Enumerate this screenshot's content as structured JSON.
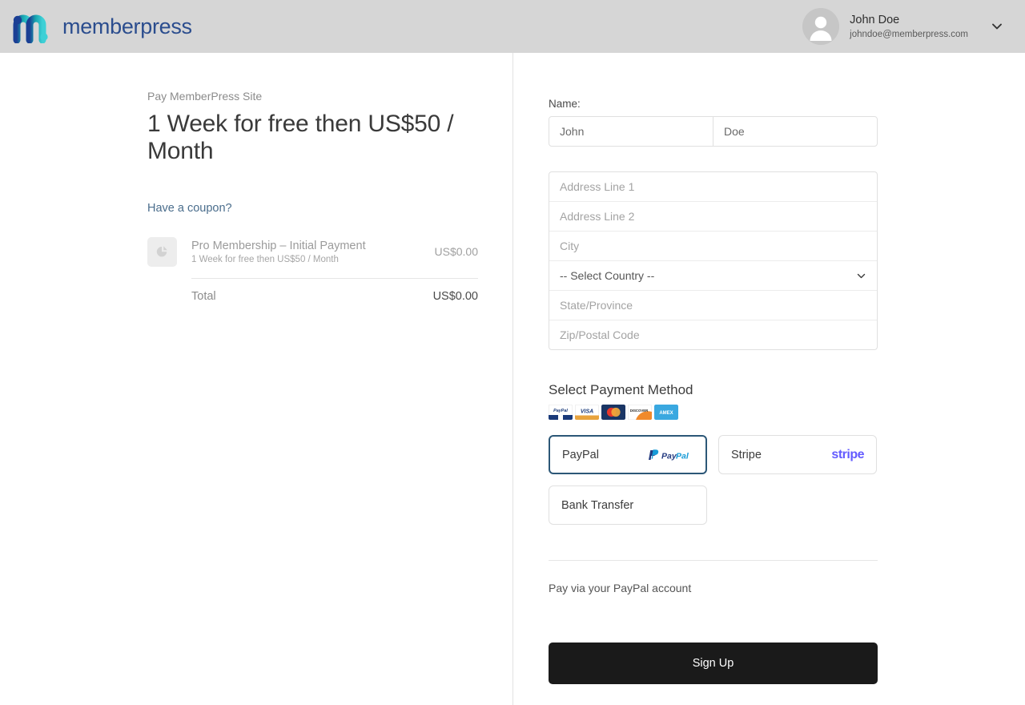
{
  "header": {
    "brand_name": "memberpress",
    "brand_logo_icon": "memberpress-m-logo",
    "user": {
      "name": "John Doe",
      "email": "johndoe@memberpress.com",
      "avatar_icon": "user-avatar-icon",
      "chevron_icon": "chevron-down-icon"
    }
  },
  "summary": {
    "pay_site_label": "Pay MemberPress Site",
    "plan_title": "1 Week for free then US$50 / Month",
    "coupon_link": "Have a coupon?",
    "item": {
      "thumb_icon": "image-placeholder-icon",
      "name": "Pro Membership – Initial Payment",
      "subtitle": "1 Week for free then US$50 / Month",
      "price": "US$0.00"
    },
    "total_label": "Total",
    "total_value": "US$0.00"
  },
  "form": {
    "name_label": "Name:",
    "first_name": "John",
    "last_name": "Doe",
    "address_line_1": "Address Line 1",
    "address_line_2": "Address Line 2",
    "city": "City",
    "country_selected": "-- Select Country --",
    "country_chevron_icon": "chevron-down-icon",
    "state_province": "State/Province",
    "zip_postal_code": "Zip/Postal Code"
  },
  "payment": {
    "title": "Select Payment Method",
    "card_badges": [
      {
        "name": "paypal-card-icon",
        "label": "PayPal"
      },
      {
        "name": "visa-card-icon",
        "label": "VISA"
      },
      {
        "name": "mastercard-card-icon",
        "label": "MasterCard"
      },
      {
        "name": "discover-card-icon",
        "label": "DISCOVER"
      },
      {
        "name": "amex-card-icon",
        "label": "AMEX"
      }
    ],
    "options": [
      {
        "label": "PayPal",
        "logo_icon": "paypal-logo-icon",
        "selected": true
      },
      {
        "label": "Stripe",
        "logo_icon": "stripe-logo-icon",
        "selected": false
      },
      {
        "label": "Bank Transfer",
        "logo_icon": "",
        "selected": false
      }
    ],
    "description": "Pay via your PayPal account",
    "submit_label": "Sign Up",
    "selected_border_color": "#2c5777",
    "stripe_color": "#635bff",
    "paypal_color": "#253b80"
  }
}
